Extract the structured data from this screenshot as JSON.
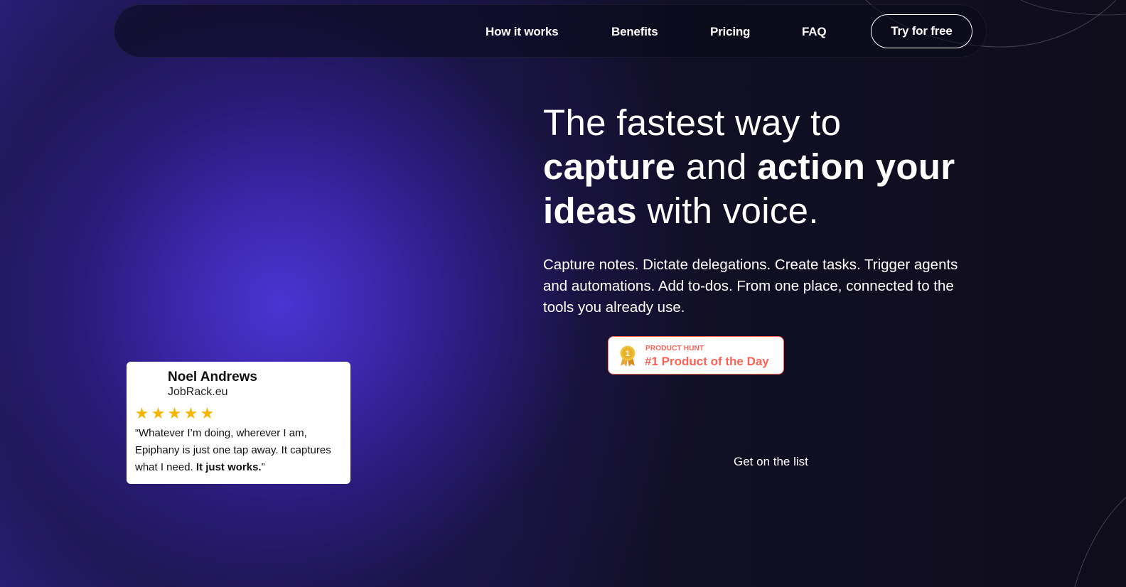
{
  "nav": {
    "items": [
      {
        "label": "How it works"
      },
      {
        "label": "Benefits"
      },
      {
        "label": "Pricing"
      },
      {
        "label": "FAQ"
      }
    ],
    "cta_label": "Try for free"
  },
  "hero": {
    "title_part1": "The fastest way to",
    "title_bold1": "capture",
    "title_part2": " and ",
    "title_bold2": "action your ideas",
    "title_part3": " with voice.",
    "subtitle": "Capture notes. Dictate delegations.  Create tasks.  Trigger agents and automations.  Add to-dos.  From one place, connected to the tools you already use."
  },
  "badge": {
    "kicker": "PRODUCT HUNT",
    "title": "#1 Product of the Day",
    "medal_number": "1",
    "color": "#ff6154"
  },
  "cta": {
    "label": "Get on the list"
  },
  "testimonial": {
    "name": "Noel Andrews",
    "company": "JobRack.eu",
    "rating": 5,
    "stars": [
      "★",
      "★",
      "★",
      "★",
      "★"
    ],
    "quote_plain": "“Whatever I’m doing, wherever I am, Epiphany is just one tap away. It captures what I need. ",
    "quote_bold": "It just works.",
    "quote_close": "”"
  },
  "colors": {
    "accent_purple": "#4b34d2",
    "background_dark": "#0f0d1c",
    "star": "#f7b500",
    "product_hunt": "#ff6154"
  }
}
